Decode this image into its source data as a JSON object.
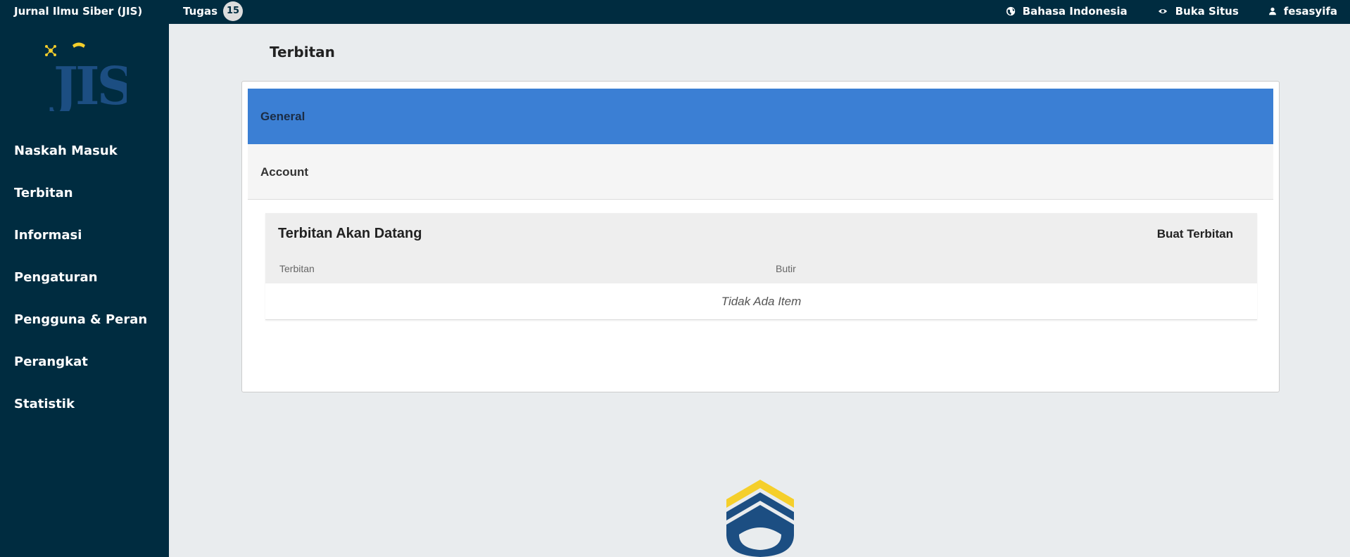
{
  "topbar": {
    "site_title": "Jurnal Ilmu Siber (JIS)",
    "tasks_label": "Tugas",
    "tasks_count": "15",
    "language_label": "Bahasa Indonesia",
    "view_site_label": "Buka Situs",
    "username": "fesasyifa"
  },
  "sidebar": {
    "logo_text": "JIS",
    "items": [
      {
        "label": "Naskah Masuk"
      },
      {
        "label": "Terbitan"
      },
      {
        "label": "Informasi"
      },
      {
        "label": "Pengaturan"
      },
      {
        "label": "Pengguna & Peran"
      },
      {
        "label": "Perangkat"
      },
      {
        "label": "Statistik"
      }
    ]
  },
  "main": {
    "page_title": "Terbitan",
    "tabs": [
      {
        "label": "General",
        "active": true
      },
      {
        "label": "Account",
        "active": false
      }
    ],
    "grid": {
      "title": "Terbitan Akan Datang",
      "action_label": "Buat Terbitan",
      "columns": [
        "Terbitan",
        "Butir"
      ],
      "empty_text": "Tidak Ada Item"
    }
  },
  "colors": {
    "topbar_bg": "#002c40",
    "accent_blue": "#3b7fd4",
    "logo_yellow": "#f5cf2b",
    "logo_blue": "#1c4e82"
  },
  "icons": {
    "language": "globe-icon",
    "view_site": "eye-icon",
    "user": "user-icon"
  }
}
